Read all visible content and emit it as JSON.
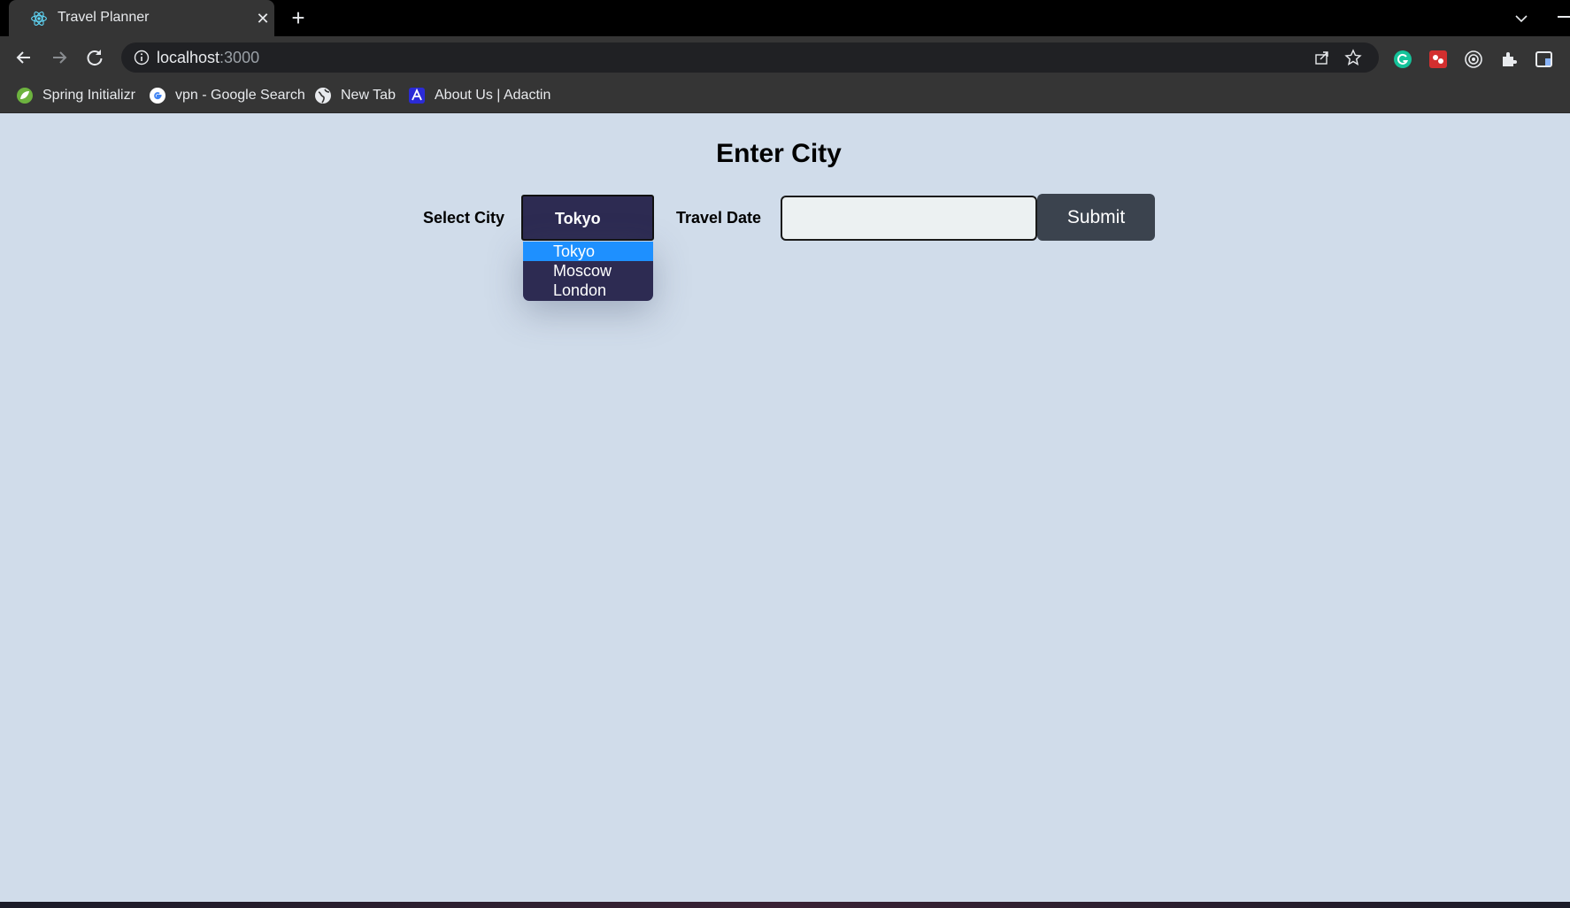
{
  "browser": {
    "tab_title": "Travel Planner",
    "tab_close": "✕",
    "new_tab": "+",
    "url_host": "localhost",
    "url_port": ":3000",
    "bookmarks": [
      {
        "label": "Spring Initializr",
        "icon": "spring-leaf-icon"
      },
      {
        "label": "vpn - Google Search",
        "icon": "google-icon"
      },
      {
        "label": "New Tab",
        "icon": "globe-icon"
      },
      {
        "label": "About Us | Adactin",
        "icon": "adactin-icon"
      }
    ],
    "extensions": [
      "grammarly-icon",
      "red-extension-icon",
      "target-extension-icon",
      "puzzle-icon",
      "side-panel-icon"
    ]
  },
  "page": {
    "title": "Enter City",
    "city_label": "Select City",
    "selected_city": "Tokyo",
    "city_options": [
      "Tokyo",
      "Moscow",
      "London"
    ],
    "date_label": "Travel Date",
    "date_value": "",
    "submit_label": "Submit"
  },
  "colors": {
    "page_background": "#d0dcea",
    "select_background": "#2d2b52",
    "option_highlight": "#1e90ff",
    "submit_background": "#3b434e",
    "chrome_dark": "#353535"
  }
}
